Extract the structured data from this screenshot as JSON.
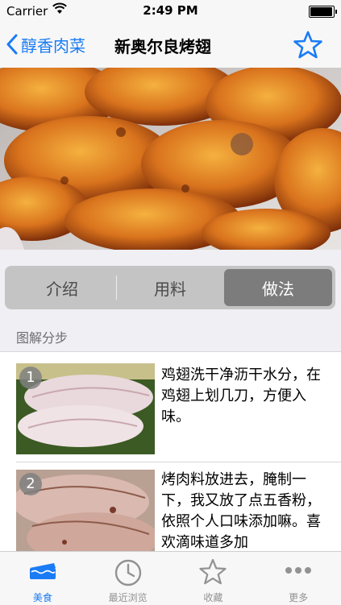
{
  "status_bar": {
    "carrier": "Carrier",
    "time": "2:49 PM",
    "battery_level": 0.95
  },
  "nav": {
    "back_label": "醇香肉菜",
    "title": "新奥尔良烤翅"
  },
  "colors": {
    "accent": "#1a7cf5",
    "segment_active": "#7c7c7c"
  },
  "hero": {
    "current_page": 1,
    "page_count": 1
  },
  "segments": [
    {
      "label": "介绍",
      "selected": false
    },
    {
      "label": "用料",
      "selected": false
    },
    {
      "label": "做法",
      "selected": true
    }
  ],
  "steps_section": {
    "header": "图解分步",
    "steps": [
      {
        "number": "1",
        "text": "鸡翅洗干净沥干水分，在鸡翅上划几刀，方便入味。"
      },
      {
        "number": "2",
        "text": "烤肉料放进去，腌制一下，我又放了点五香粉，依照个人口味添加嘛。喜欢滴味道多加"
      }
    ]
  },
  "tabbar": {
    "items": [
      {
        "label": "美食",
        "icon": "cake-icon",
        "active": true
      },
      {
        "label": "最近浏览",
        "icon": "clock-icon",
        "active": false
      },
      {
        "label": "收藏",
        "icon": "star-icon",
        "active": false
      },
      {
        "label": "更多",
        "icon": "more-dots-icon",
        "active": false
      }
    ]
  }
}
